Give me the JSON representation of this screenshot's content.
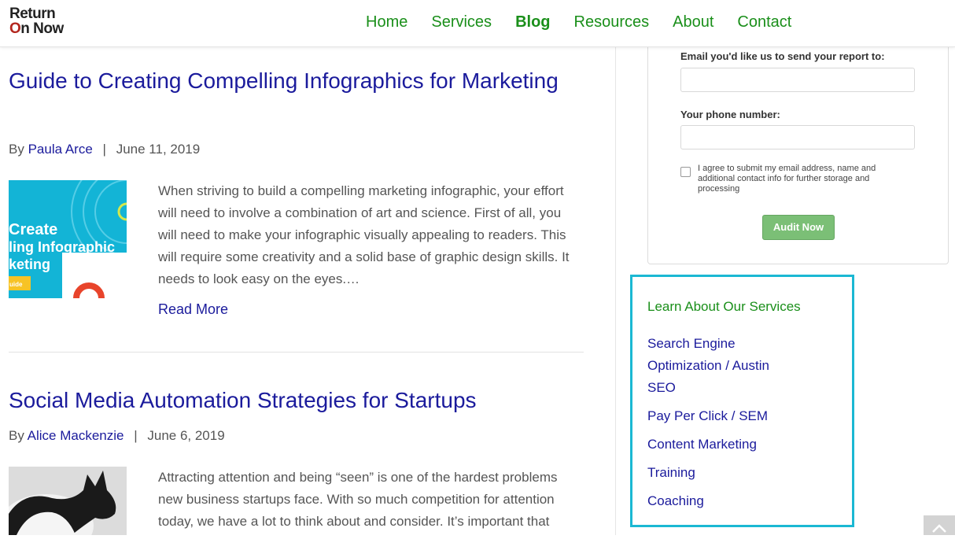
{
  "header": {
    "logo_line1": "Return",
    "logo_o": "O",
    "logo_line2_rest": "n Now",
    "nav": [
      {
        "label": "Home"
      },
      {
        "label": "Services"
      },
      {
        "label": "Blog"
      },
      {
        "label": "Resources"
      },
      {
        "label": "About"
      },
      {
        "label": "Contact"
      }
    ]
  },
  "posts": [
    {
      "title": "Guide to Creating Compelling Infographics for Marketing",
      "by": "By",
      "author": "Paula Arce",
      "separator": "|",
      "date": "June 11, 2019",
      "thumb_text": [
        "Create",
        "ling Infographic",
        "keting",
        "uide"
      ],
      "excerpt": "When striving to build a compelling marketing infographic, your effort will need to involve a combination of art and science. First of all, you will need to make your infographic visually appealing to readers. This will require some creativity and a solid base of graphic design skills. It needs to look easy on the eyes.…",
      "read_more": "Read More"
    },
    {
      "title": "Social Media Automation Strategies for Startups",
      "by": "By",
      "author": "Alice Mackenzie",
      "separator": "|",
      "date": "June 6, 2019",
      "excerpt": "Attracting attention and being “seen” is one of the hardest problems new business startups face. With so much competition for attention today, we have a lot to think about and consider. It’s important that"
    }
  ],
  "audit_form": {
    "email_label": "Email you'd like us to send your report to:",
    "email_value": "",
    "phone_label": "Your phone number:",
    "phone_value": "",
    "consent_text": "I agree to submit my email address, name and additional contact info for further storage and processing",
    "submit_label": "Audit Now"
  },
  "services_widget": {
    "title": "Learn About Our Services",
    "items": [
      {
        "label": "Search Engine Optimization / Austin SEO"
      },
      {
        "label": "Pay Per Click / SEM"
      },
      {
        "label": "Content Marketing"
      },
      {
        "label": "Training"
      },
      {
        "label": "Coaching"
      }
    ]
  },
  "colors": {
    "nav_green": "#1a8f1a",
    "link_blue": "#1b1b9c",
    "services_border": "#1bb8d3",
    "audit_button": "#7bbf76",
    "logo_red": "#b3261e"
  },
  "icons": {
    "scroll_top": "chevron-up-icon"
  }
}
